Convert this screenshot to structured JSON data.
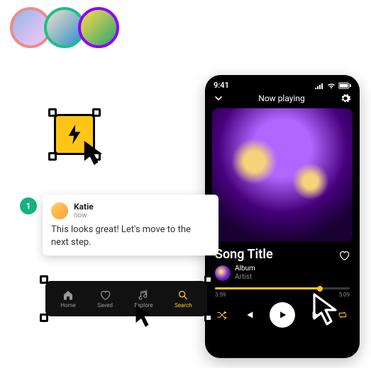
{
  "phone": {
    "time": "9:41",
    "now_playing_label": "Now playing",
    "song_title": "Song Title",
    "album": "Album",
    "artist": "Artist",
    "elapsed": "3:59",
    "duration": "5:09"
  },
  "comment": {
    "badge": "1",
    "author": "Katie",
    "time": "now",
    "body": "This looks great! Let's move to the next step."
  },
  "nav": {
    "home": "Home",
    "saved": "Saved",
    "explore": "Explore",
    "search": "Search"
  }
}
